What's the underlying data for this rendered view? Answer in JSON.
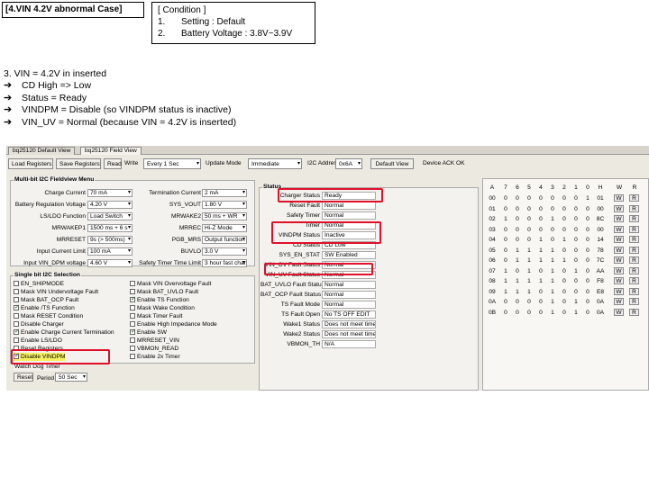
{
  "slide": {
    "title": "[4.VIN 4.2V abnormal Case]",
    "condition_header": "[ Condition ]",
    "conditions": [
      {
        "num": "1.",
        "text": "Setting : Default"
      },
      {
        "num": "2.",
        "text": "Battery Voltage : 3.8V~3.9V"
      }
    ],
    "notes_header": "3. VIN = 4.2V in inserted",
    "notes": [
      "CD High => Low",
      "Status = Ready",
      "VINDPM = Disable (so VINDPM status is inactive)",
      "VIN_UV = Normal (because VIN = 4.2V is inserted)"
    ],
    "arrow_glyph": "➔"
  },
  "app": {
    "tabs": [
      "bq25120 Default View",
      "bq25120 Field View"
    ],
    "toolbar": {
      "load_registers": "Load Registers",
      "save_registers": "Save Registers",
      "read": "Read",
      "write_label": "Write",
      "write_value": "Every 1 Sec",
      "update_mode_label": "Update Mode",
      "update_mode_value": "Immediate",
      "i2c_address_label": "I2C Address",
      "i2c_address_value": "0x6A",
      "default_view": "Default View",
      "device_ack": "Device ACK OK"
    },
    "left_panel": {
      "title": "Multi-bit I2C Fieldview Menu",
      "fields": [
        {
          "label": "Charge Current",
          "value": "70 mA"
        },
        {
          "label": "Battery Regulation Voltage",
          "value": "4.20 V"
        },
        {
          "label": "LS/LDO Function",
          "value": "Load Switch"
        },
        {
          "label": "MRWAKEP1",
          "value": "1500 ms + 6 s"
        },
        {
          "label": "MRRESET",
          "value": "9s   (> 500ms)"
        },
        {
          "label": "Input Current Limit",
          "value": "100 mA"
        },
        {
          "label": "Input VIN_DPM voltage",
          "value": "4.60 V"
        }
      ],
      "mid_fields": [
        {
          "label": "Termination Current",
          "value": "2 mA"
        },
        {
          "label": "SYS_VOUT",
          "value": "1.80 V"
        },
        {
          "label": "MRWAKE2",
          "value": "50 ms + WR"
        },
        {
          "label": "MRREC",
          "value": "Hi-Z Mode"
        },
        {
          "label": "PGB_MRS",
          "value": "Output function"
        },
        {
          "label": "BUVLO",
          "value": "3.0 V"
        },
        {
          "label": "Safety Timer Time Limit",
          "value": "3 hour fast charge"
        }
      ],
      "checks_title": "Single bit I2C Selection",
      "checks_left": [
        {
          "label": "EN_SHIPMODE",
          "on": false
        },
        {
          "label": "Mask VIN Undervoltage Fault",
          "on": false
        },
        {
          "label": "Mask BAT_OCP Fault",
          "on": false
        },
        {
          "label": "Enable /TS Function",
          "on": true
        },
        {
          "label": "Mask RESET Condition",
          "on": false
        },
        {
          "label": "Disable Charger",
          "on": false
        },
        {
          "label": "Enable Charge Current Termination",
          "on": true
        },
        {
          "label": "Enable LS/LDO",
          "on": false
        },
        {
          "label": "Reset Registers",
          "on": false
        },
        {
          "label": "Disable VINDPM",
          "on": true
        }
      ],
      "checks_right": [
        {
          "label": "Mask VIN Overvoltage Fault",
          "on": false
        },
        {
          "label": "Mask BAT_UVLO Fault",
          "on": false
        },
        {
          "label": "Enable TS Function",
          "on": true
        },
        {
          "label": "Mask Wake Condition",
          "on": false
        },
        {
          "label": "Mask Timer Fault",
          "on": false
        },
        {
          "label": "Enable High Impedance Mode",
          "on": false
        },
        {
          "label": "Enable SW",
          "on": true
        },
        {
          "label": "MRRESET_VIN",
          "on": false
        },
        {
          "label": "VBMON_READ",
          "on": false
        },
        {
          "label": "Enable 2x Timer",
          "on": false
        }
      ],
      "watchdog_title": "Watch Dog Timer",
      "reset_button": "Reset",
      "period_label": "Period",
      "period_value": "50 Sec"
    },
    "status_panel": {
      "title": "Status",
      "items": [
        {
          "label": "Charger Status",
          "value": "Ready"
        },
        {
          "label": "Reset Fault",
          "value": "Normal"
        },
        {
          "label": "Safety Timer",
          "value": "Normal"
        },
        {
          "label": "Timer",
          "value": "Normal"
        },
        {
          "label": "VINDPM Status",
          "value": "Inactive"
        },
        {
          "label": "CD Status",
          "value": "CD Low"
        },
        {
          "label": "SYS_EN_STAT",
          "value": "SW Enabled"
        },
        {
          "label": "VIN_OV Fault Status",
          "value": "Normal"
        },
        {
          "label": "VIN_UV Fault Status",
          "value": "Normal"
        },
        {
          "label": "BAT_UVLO Fault Status",
          "value": "Normal"
        },
        {
          "label": "BAT_OCP Fault Status",
          "value": "Normal"
        },
        {
          "label": "TS Fault Mode",
          "value": "Normal"
        },
        {
          "label": "TS Fault Open",
          "value": "No TS OFF EDIT"
        },
        {
          "label": "Wake1 Status",
          "value": "Does not meet time"
        },
        {
          "label": "Wake2 Status",
          "value": "Does not meet time"
        },
        {
          "label": "VBMON_TH",
          "value": "N/A"
        }
      ]
    },
    "register_grid": {
      "headers": [
        "A",
        "7",
        "6",
        "5",
        "4",
        "3",
        "2",
        "1",
        "0",
        "H",
        "W",
        "R"
      ],
      "rows": [
        [
          "00",
          "0",
          "0",
          "0",
          "0",
          "0",
          "0",
          "0",
          "1",
          "01",
          "W",
          "R"
        ],
        [
          "01",
          "0",
          "0",
          "0",
          "0",
          "0",
          "0",
          "0",
          "0",
          "00",
          "W",
          "R"
        ],
        [
          "02",
          "1",
          "0",
          "0",
          "0",
          "1",
          "0",
          "0",
          "0",
          "8C",
          "W",
          "R"
        ],
        [
          "03",
          "0",
          "0",
          "0",
          "0",
          "0",
          "0",
          "0",
          "0",
          "00",
          "W",
          "R"
        ],
        [
          "04",
          "0",
          "0",
          "0",
          "1",
          "0",
          "1",
          "0",
          "0",
          "14",
          "W",
          "R"
        ],
        [
          "05",
          "0",
          "1",
          "1",
          "1",
          "1",
          "0",
          "0",
          "0",
          "78",
          "W",
          "R"
        ],
        [
          "06",
          "0",
          "1",
          "1",
          "1",
          "1",
          "1",
          "0",
          "0",
          "7C",
          "W",
          "R"
        ],
        [
          "07",
          "1",
          "0",
          "1",
          "0",
          "1",
          "0",
          "1",
          "0",
          "AA",
          "W",
          "R"
        ],
        [
          "08",
          "1",
          "1",
          "1",
          "1",
          "1",
          "0",
          "0",
          "0",
          "F8",
          "W",
          "R"
        ],
        [
          "09",
          "1",
          "1",
          "1",
          "0",
          "1",
          "0",
          "0",
          "0",
          "E8",
          "W",
          "R"
        ],
        [
          "0A",
          "0",
          "0",
          "0",
          "0",
          "1",
          "0",
          "1",
          "0",
          "0A",
          "W",
          "R"
        ],
        [
          "0B",
          "0",
          "0",
          "0",
          "0",
          "1",
          "0",
          "1",
          "0",
          "0A",
          "W",
          "R"
        ]
      ]
    },
    "colors": {
      "highlight": "#e0102a",
      "panel": "#f4f2ee"
    }
  }
}
